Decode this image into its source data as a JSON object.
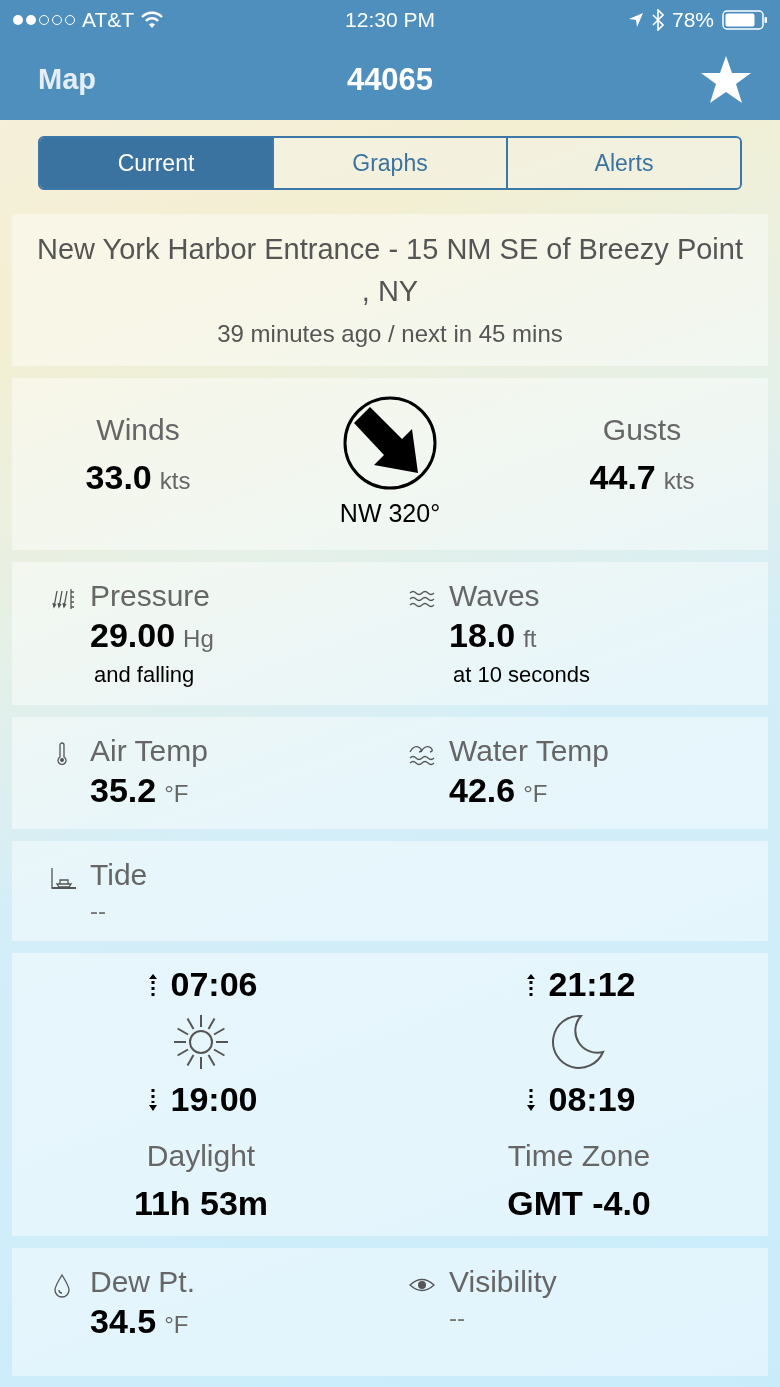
{
  "status_bar": {
    "carrier": "AT&T",
    "time": "12:30 PM",
    "battery": "78%"
  },
  "nav": {
    "back": "Map",
    "title": "44065"
  },
  "tabs": [
    {
      "label": "Current",
      "selected": true
    },
    {
      "label": "Graphs",
      "selected": false
    },
    {
      "label": "Alerts",
      "selected": false
    }
  ],
  "station": {
    "name": "New York Harbor Entrance - 15 NM SE of Breezy Point , NY",
    "updated": "39 minutes ago / next in 45 mins"
  },
  "winds": {
    "label": "Winds",
    "value": "33.0",
    "unit": "kts",
    "direction": "NW 320°",
    "gusts_label": "Gusts",
    "gusts_value": "44.7",
    "gusts_unit": "kts"
  },
  "metric_rows": [
    [
      {
        "kind": "pressure",
        "label": "Pressure",
        "value": "29.00",
        "unit": "Hg",
        "note": "and falling"
      },
      {
        "kind": "waves",
        "label": "Waves",
        "value": "18.0",
        "unit": "ft",
        "note": "at 10 seconds"
      }
    ],
    [
      {
        "kind": "air_temp",
        "label": "Air Temp",
        "value": "35.2",
        "unit": "°F"
      },
      {
        "kind": "water_temp",
        "label": "Water Temp",
        "value": "42.6",
        "unit": "°F"
      }
    ],
    [
      {
        "kind": "tide",
        "label": "Tide",
        "value": "--"
      }
    ]
  ],
  "astro": [
    {
      "kind": "sun",
      "rise": "07:06",
      "set": "19:00",
      "label": "Daylight",
      "value": "11h 53m"
    },
    {
      "kind": "moon",
      "rise": "21:12",
      "set": "08:19",
      "label": "Time Zone",
      "value": "GMT -4.0"
    }
  ],
  "bottom_row": [
    {
      "kind": "dew_point",
      "label": "Dew Pt.",
      "value": "34.5",
      "unit": "°F"
    },
    {
      "kind": "visibility",
      "label": "Visibility",
      "value": "--"
    }
  ]
}
